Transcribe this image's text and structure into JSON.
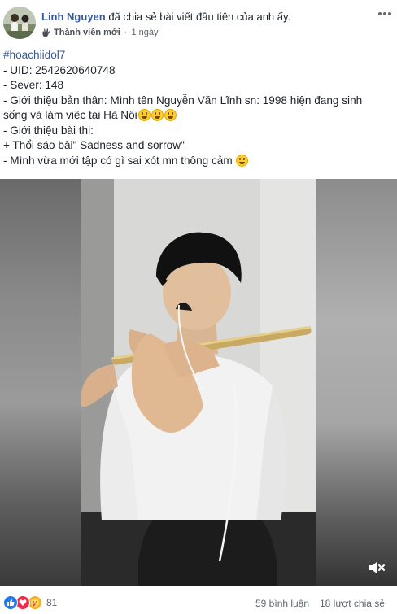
{
  "header": {
    "author_name": "Linh Nguyen",
    "action_text": "đã chia sẻ bài viết đầu tiên của anh ấy.",
    "member_badge": "Thành viên mới",
    "separator": "·",
    "timestamp": "1 ngày"
  },
  "post": {
    "hashtag": "#hoachiidol7",
    "uid_line": "- UID: 2542620640748",
    "server_line": "- Sever: 148",
    "intro_line_1": "- Giới thiệu bản thân: Mình tên Nguyễn Văn Lĩnh sn: 1998 hiện đang sinh",
    "intro_line_2": "sống và làm việc tại Hà Nội",
    "song_intro": "- Giới thiệu bài thi:",
    "song_line": "+ Thổi sáo bài\" Sadness and sorrow\"",
    "closing_line": "- Mình vừa mới tập có gì sai xót mn thông cảm"
  },
  "footer": {
    "reaction_count": "81",
    "comments": "59 bình luận",
    "shares": "18 lượt chia sẻ"
  },
  "icons": {
    "more": "more-dots-icon",
    "member": "wave-hand-icon",
    "mute": "speaker-muted-icon",
    "reactions": [
      "like-icon",
      "love-icon",
      "care-icon"
    ]
  },
  "colors": {
    "link": "#365899",
    "text": "#1d2129",
    "muted": "#616770",
    "like": "#2078f4",
    "love": "#f0284a",
    "care": "#f7b125"
  }
}
